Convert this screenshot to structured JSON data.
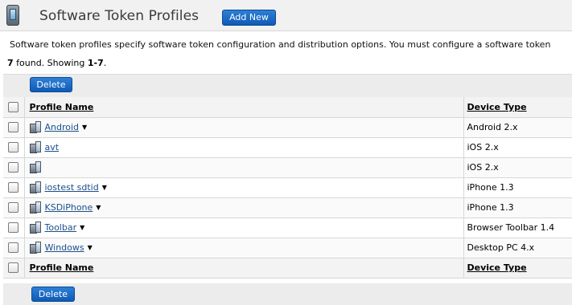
{
  "header": {
    "title": "Software Token Profiles",
    "add_new_label": "Add New",
    "icon": "phone-icon"
  },
  "description": "Software token profiles specify software token configuration and distribution options. You must configure a software token",
  "summary": {
    "count": "7",
    "found_text": " found. Showing ",
    "range": "1-7",
    "end": "."
  },
  "toolbar": {
    "delete_label": "Delete"
  },
  "table": {
    "columns": [
      "Profile Name",
      "Device Type"
    ],
    "rows": [
      {
        "name": "Android",
        "device": "Android 2.x",
        "has_menu": true
      },
      {
        "name": "avt",
        "device": "iOS 2.x",
        "has_menu": false
      },
      {
        "name": "",
        "device": "iOS 2.x",
        "has_menu": false
      },
      {
        "name": "iostest sdtid",
        "device": "iPhone 1.3",
        "has_menu": true
      },
      {
        "name": "KSDiPhone",
        "device": "iPhone 1.3",
        "has_menu": true
      },
      {
        "name": "Toolbar",
        "device": "Browser Toolbar 1.4",
        "has_menu": true
      },
      {
        "name": "Windows",
        "device": "Desktop PC 4.x",
        "has_menu": true
      }
    ]
  },
  "footer": {
    "delete_label": "Delete"
  },
  "colors": {
    "button": "#0e5bb5",
    "link": "#1b4f8a"
  }
}
